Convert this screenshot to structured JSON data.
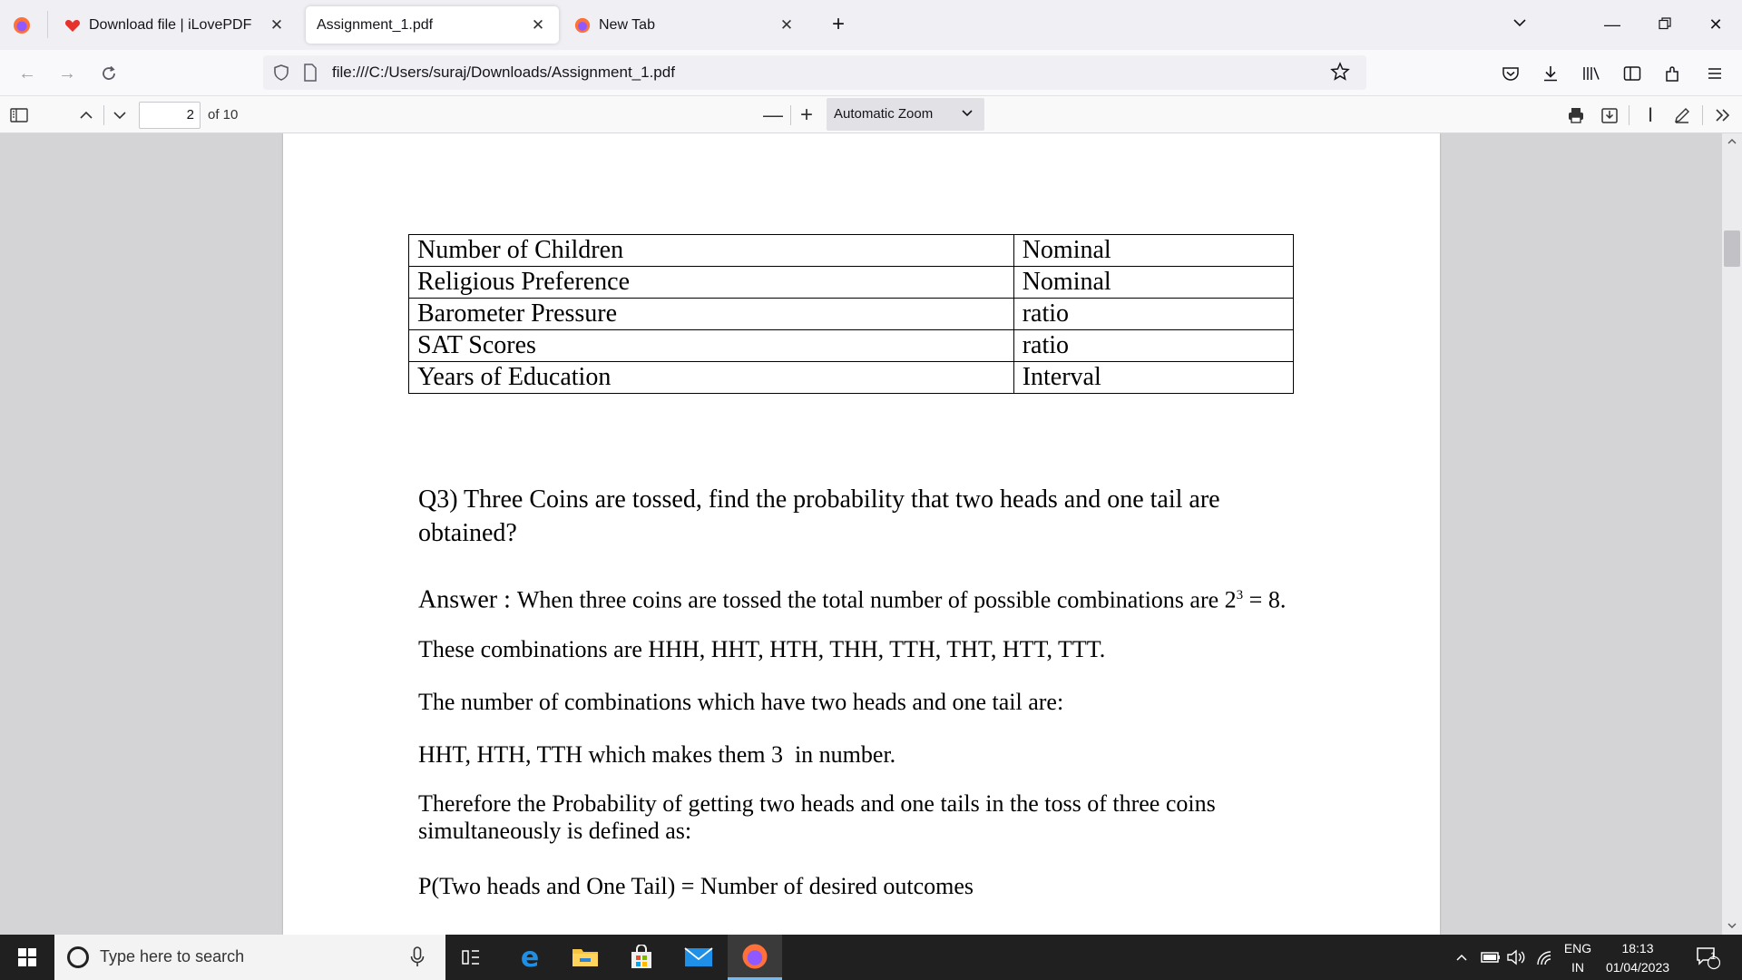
{
  "browser": {
    "tabs": [
      {
        "title": "Download file | iLovePDF",
        "active": false
      },
      {
        "title": "Assignment_1.pdf",
        "active": true
      },
      {
        "title": "New Tab",
        "active": false
      }
    ],
    "url": "file:///C:/Users/suraj/Downloads/Assignment_1.pdf"
  },
  "pdf_toolbar": {
    "page_number": "2",
    "page_of": "of 10",
    "zoom": "Automatic Zoom"
  },
  "document": {
    "table": [
      [
        "Number of Children",
        "Nominal"
      ],
      [
        "Religious Preference",
        "Nominal"
      ],
      [
        "Barometer Pressure",
        "ratio"
      ],
      [
        "SAT Scores",
        "ratio"
      ],
      [
        "Years of Education",
        "Interval"
      ]
    ],
    "q3_line1": "Q3) Three Coins are tossed, find the probability that two heads and one tail are",
    "q3_line2": "obtained?",
    "answer_label": "Answer",
    "answer_sep": " : ",
    "answer_text": "When three coins are tossed the total number of possible combinations are 2",
    "answer_exp": "3",
    "answer_tail": " = 8.",
    "combos": "These combinations are HHH, HHT, HTH, THH, TTH, THT, HTT, TTT.",
    "two_heads_intro": "The number of combinations which have two heads and one tail are:",
    "two_heads_list": "HHT, HTH, TTH which makes them 3  in number.",
    "therefore_line1": "Therefore the Probability of getting two heads and one tails in the toss of three coins",
    "therefore_line2": "simultaneously is defined as:",
    "formula": "P(Two heads and One Tail) = Number of desired outcomes"
  },
  "taskbar": {
    "search_placeholder": "Type here to search",
    "lang_top": "ENG",
    "lang_bottom": "IN",
    "time": "18:13",
    "date": "01/04/2023",
    "notifications": "1"
  }
}
